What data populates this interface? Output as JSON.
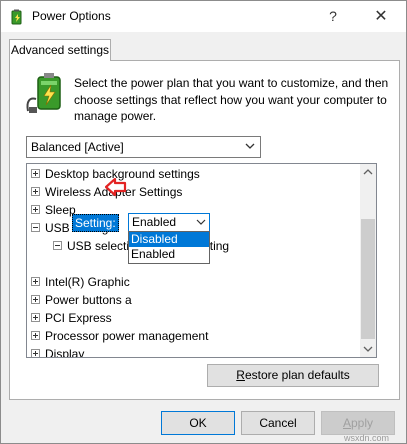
{
  "window": {
    "title": "Power Options",
    "help_glyph": "?",
    "close_glyph": "✕"
  },
  "tab": {
    "label": "Advanced settings"
  },
  "intro": {
    "text": "Select the power plan that you want to customize, and then choose settings that reflect how you want your computer to manage power."
  },
  "plan_select": {
    "value": "Balanced [Active]"
  },
  "tree": {
    "items": [
      {
        "label": "Desktop background settings",
        "expander": "+"
      },
      {
        "label": "Wireless Adapter Settings",
        "expander": "+"
      },
      {
        "label": "Sleep",
        "expander": "+"
      },
      {
        "label": "USB settings",
        "expander": "-"
      },
      {
        "label": "USB selective suspend setting",
        "expander": "-"
      },
      {
        "label": "Intel(R) Graphic",
        "expander": "+"
      },
      {
        "label": "Power buttons a",
        "expander": "+"
      },
      {
        "label": "PCI Express",
        "expander": "+"
      },
      {
        "label": "Processor power management",
        "expander": "+"
      },
      {
        "label": "Display",
        "expander": "+"
      }
    ],
    "setting_label": "Setting:",
    "setting_value": "Enabled",
    "dropdown_options": [
      "Disabled",
      "Enabled"
    ]
  },
  "buttons": {
    "restore_prefix": "R",
    "restore_rest": "estore plan defaults",
    "ok": "OK",
    "cancel": "Cancel",
    "apply_prefix": "A",
    "apply_rest": "pply"
  },
  "watermark": "wsxdn.com",
  "colors": {
    "selection_blue": "#0078d7",
    "annotation_red": "#e32323",
    "battery_green": "#3a9a2a"
  },
  "icons": {
    "app": "power-options-icon",
    "panel": "battery-plug-icon",
    "annotation": "red-arrow-icon"
  }
}
